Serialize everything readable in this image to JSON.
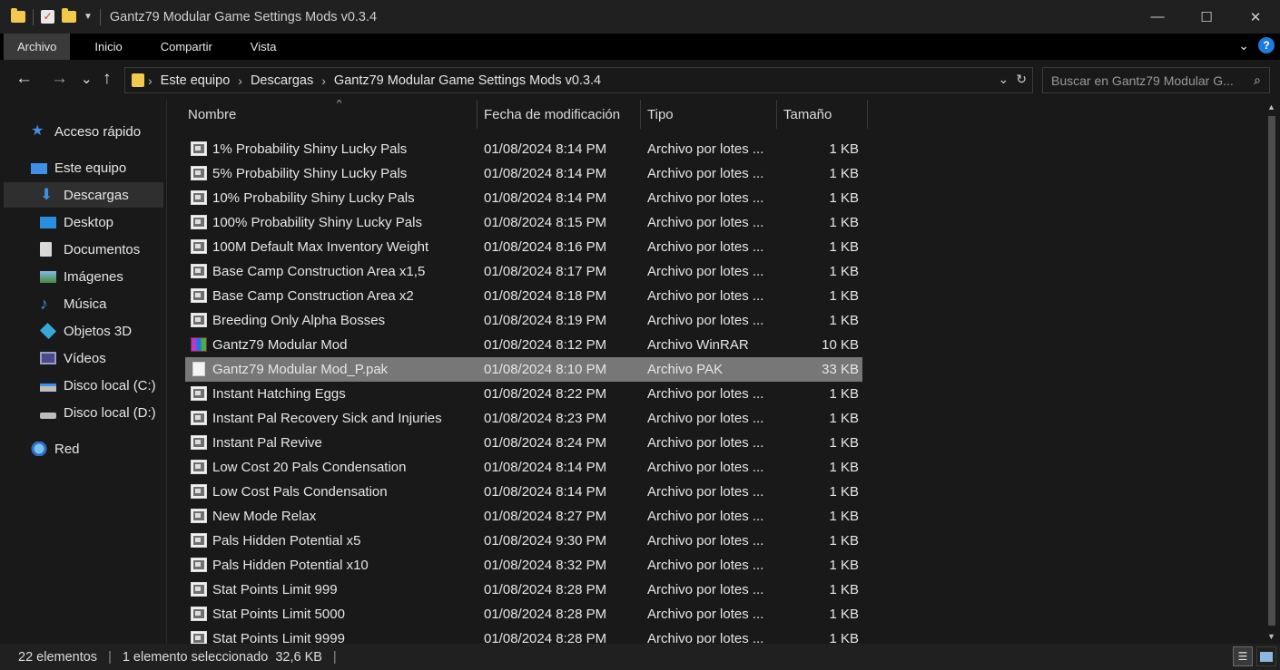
{
  "window": {
    "title": "Gantz79 Modular Game Settings Mods v0.3.4",
    "controls": {
      "minimize": "—",
      "maximize": "☐",
      "close": "✕"
    }
  },
  "ribbon": {
    "tabs": [
      {
        "label": "Archivo"
      },
      {
        "label": "Inicio"
      },
      {
        "label": "Compartir"
      },
      {
        "label": "Vista"
      }
    ],
    "help": "?"
  },
  "nav": {
    "back": "←",
    "forward": "→",
    "recent": "⌄",
    "up": "↑"
  },
  "address": {
    "crumbs": [
      "Este equipo",
      "Descargas",
      "Gantz79 Modular Game Settings Mods v0.3.4"
    ]
  },
  "search": {
    "placeholder": "Buscar en Gantz79 Modular G..."
  },
  "sidebar": {
    "items": [
      {
        "label": "Acceso rápido",
        "icon": "star-icon"
      },
      {
        "label": "Este equipo",
        "icon": "computer-icon"
      },
      {
        "label": "Descargas",
        "icon": "download-icon"
      },
      {
        "label": "Desktop",
        "icon": "desktop-icon"
      },
      {
        "label": "Documentos",
        "icon": "documents-icon"
      },
      {
        "label": "Imágenes",
        "icon": "pictures-icon"
      },
      {
        "label": "Música",
        "icon": "music-icon"
      },
      {
        "label": "Objetos 3D",
        "icon": "objects-3d-icon"
      },
      {
        "label": "Vídeos",
        "icon": "videos-icon"
      },
      {
        "label": "Disco local (C:)",
        "icon": "drive-c-icon"
      },
      {
        "label": "Disco local (D:)",
        "icon": "drive-d-icon"
      },
      {
        "label": "Red",
        "icon": "network-icon"
      }
    ]
  },
  "columns": {
    "name": "Nombre",
    "date": "Fecha de modificación",
    "type": "Tipo",
    "size": "Tamaño"
  },
  "files": [
    {
      "name": "1% Probability Shiny Lucky Pals",
      "date": "01/08/2024 8:14 PM",
      "type": "Archivo por lotes ...",
      "size": "1 KB",
      "icon": "batch-file-icon"
    },
    {
      "name": "5% Probability Shiny Lucky Pals",
      "date": "01/08/2024 8:14 PM",
      "type": "Archivo por lotes ...",
      "size": "1 KB",
      "icon": "batch-file-icon"
    },
    {
      "name": "10% Probability Shiny Lucky Pals",
      "date": "01/08/2024 8:14 PM",
      "type": "Archivo por lotes ...",
      "size": "1 KB",
      "icon": "batch-file-icon"
    },
    {
      "name": "100% Probability Shiny Lucky Pals",
      "date": "01/08/2024 8:15 PM",
      "type": "Archivo por lotes ...",
      "size": "1 KB",
      "icon": "batch-file-icon"
    },
    {
      "name": "100M Default Max Inventory Weight",
      "date": "01/08/2024 8:16 PM",
      "type": "Archivo por lotes ...",
      "size": "1 KB",
      "icon": "batch-file-icon"
    },
    {
      "name": "Base Camp Construction Area x1,5",
      "date": "01/08/2024 8:17 PM",
      "type": "Archivo por lotes ...",
      "size": "1 KB",
      "icon": "batch-file-icon"
    },
    {
      "name": "Base Camp Construction Area x2",
      "date": "01/08/2024 8:18 PM",
      "type": "Archivo por lotes ...",
      "size": "1 KB",
      "icon": "batch-file-icon"
    },
    {
      "name": "Breeding Only Alpha Bosses",
      "date": "01/08/2024 8:19 PM",
      "type": "Archivo por lotes ...",
      "size": "1 KB",
      "icon": "batch-file-icon"
    },
    {
      "name": "Gantz79 Modular Mod",
      "date": "01/08/2024 8:12 PM",
      "type": "Archivo WinRAR",
      "size": "10 KB",
      "icon": "winrar-icon"
    },
    {
      "name": "Gantz79 Modular Mod_P.pak",
      "date": "01/08/2024 8:10 PM",
      "type": "Archivo PAK",
      "size": "33 KB",
      "icon": "pak-file-icon"
    },
    {
      "name": "Instant Hatching Eggs",
      "date": "01/08/2024 8:22 PM",
      "type": "Archivo por lotes ...",
      "size": "1 KB",
      "icon": "batch-file-icon"
    },
    {
      "name": "Instant Pal Recovery Sick and Injuries",
      "date": "01/08/2024 8:23 PM",
      "type": "Archivo por lotes ...",
      "size": "1 KB",
      "icon": "batch-file-icon"
    },
    {
      "name": "Instant Pal Revive",
      "date": "01/08/2024 8:24 PM",
      "type": "Archivo por lotes ...",
      "size": "1 KB",
      "icon": "batch-file-icon"
    },
    {
      "name": "Low Cost 20 Pals Condensation",
      "date": "01/08/2024 8:14 PM",
      "type": "Archivo por lotes ...",
      "size": "1 KB",
      "icon": "batch-file-icon"
    },
    {
      "name": "Low Cost Pals Condensation",
      "date": "01/08/2024 8:14 PM",
      "type": "Archivo por lotes ...",
      "size": "1 KB",
      "icon": "batch-file-icon"
    },
    {
      "name": "New Mode Relax",
      "date": "01/08/2024 8:27 PM",
      "type": "Archivo por lotes ...",
      "size": "1 KB",
      "icon": "batch-file-icon"
    },
    {
      "name": "Pals Hidden Potential x5",
      "date": "01/08/2024 9:30 PM",
      "type": "Archivo por lotes ...",
      "size": "1 KB",
      "icon": "batch-file-icon"
    },
    {
      "name": "Pals Hidden Potential x10",
      "date": "01/08/2024 8:32 PM",
      "type": "Archivo por lotes ...",
      "size": "1 KB",
      "icon": "batch-file-icon"
    },
    {
      "name": "Stat Points Limit 999",
      "date": "01/08/2024 8:28 PM",
      "type": "Archivo por lotes ...",
      "size": "1 KB",
      "icon": "batch-file-icon"
    },
    {
      "name": "Stat Points Limit 5000",
      "date": "01/08/2024 8:28 PM",
      "type": "Archivo por lotes ...",
      "size": "1 KB",
      "icon": "batch-file-icon"
    },
    {
      "name": "Stat Points Limit 9999",
      "date": "01/08/2024 8:28 PM",
      "type": "Archivo por lotes ...",
      "size": "1 KB",
      "icon": "batch-file-icon"
    }
  ],
  "selected_index": 9,
  "status": {
    "count": "22 elementos",
    "selection": "1 elemento seleccionado  32,6 KB"
  },
  "colors": {
    "background": "#191919",
    "selection": "#777777",
    "sidebar_selected": "#2f2f2f",
    "accent_blue": "#1d7adf",
    "folder_yellow": "#f2c94c"
  }
}
